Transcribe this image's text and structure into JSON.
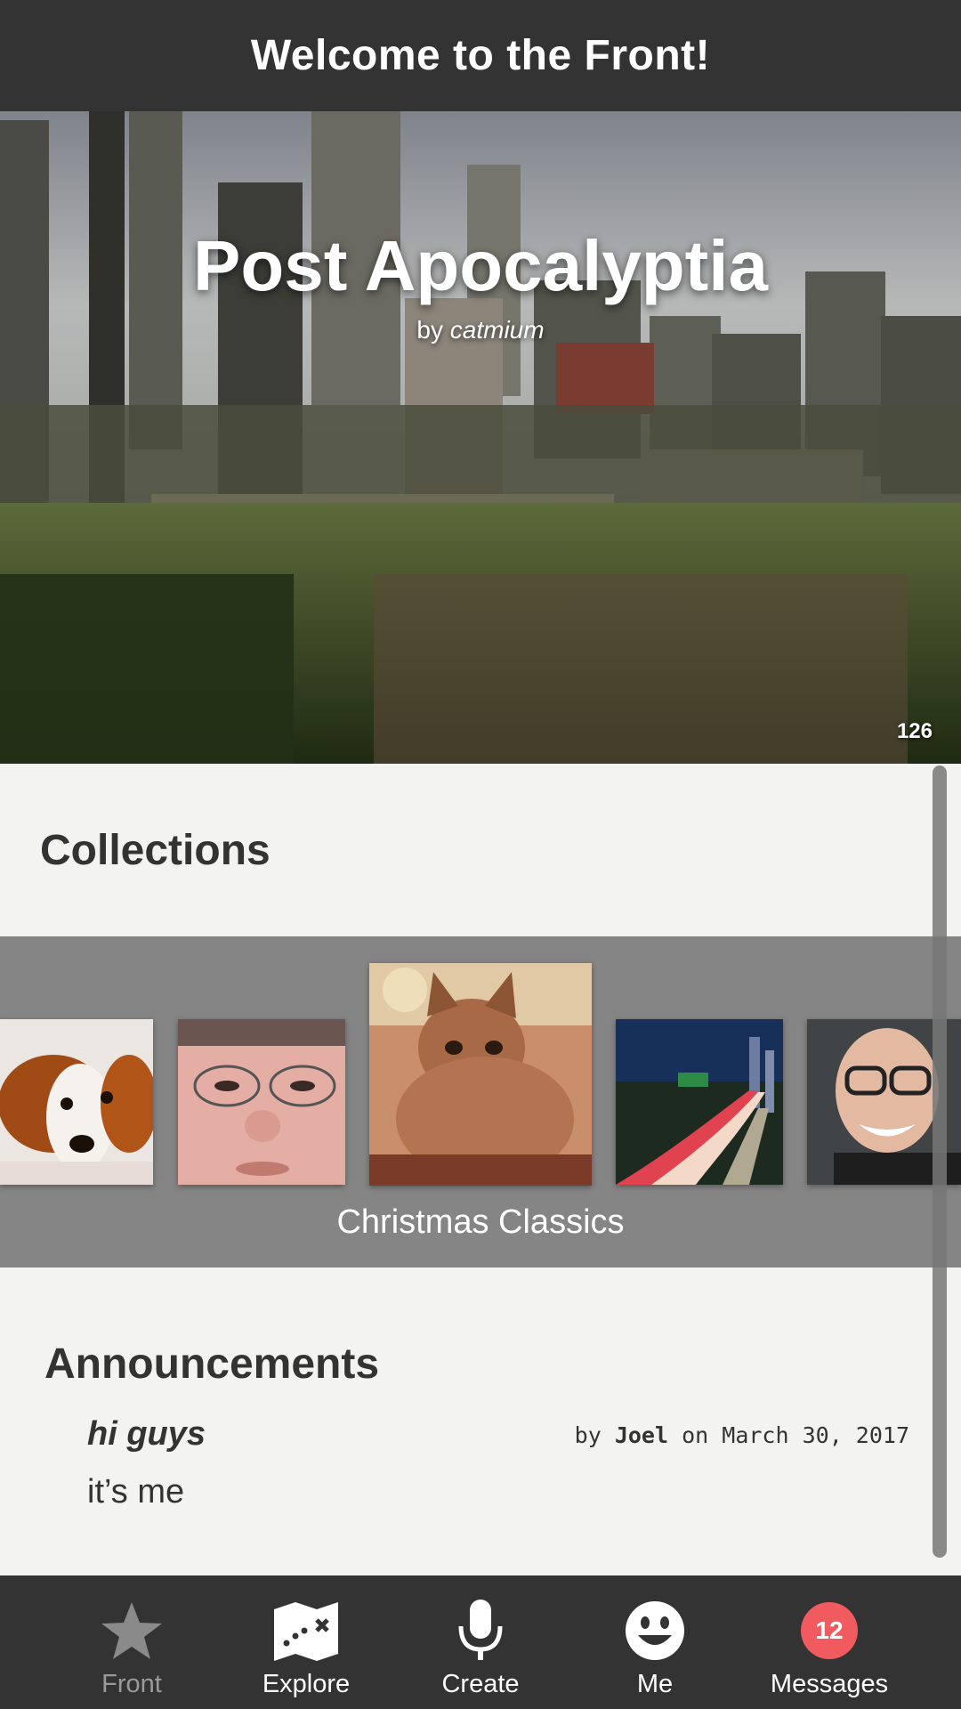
{
  "header": {
    "title": "Welcome to the Front!"
  },
  "featured": {
    "title": "Post Apocalyptia",
    "by_prefix": "by",
    "author": "catmium",
    "count": "126"
  },
  "collections": {
    "heading": "Collections",
    "current_label": "Christmas Classics",
    "thumbnails": [
      {
        "subject": "puppy"
      },
      {
        "subject": "girl-with-glasses"
      },
      {
        "subject": "cat"
      },
      {
        "subject": "city-highway-night"
      },
      {
        "subject": "smiling-man-with-glasses"
      }
    ]
  },
  "announcements": {
    "heading": "Announcements",
    "items": [
      {
        "title": "hi guys",
        "by_prefix": "by",
        "author": "Joel",
        "on_prefix": "on",
        "date": "March 30, 2017",
        "body": "it’s me"
      }
    ]
  },
  "nav": {
    "items": [
      {
        "label": "Front",
        "icon": "star-icon",
        "active": false
      },
      {
        "label": "Explore",
        "icon": "map-icon",
        "active": true
      },
      {
        "label": "Create",
        "icon": "microphone-icon",
        "active": true
      },
      {
        "label": "Me",
        "icon": "smiley-icon",
        "active": true
      },
      {
        "label": "Messages",
        "icon": "messages-badge",
        "badge": "12",
        "active": true
      }
    ]
  },
  "colors": {
    "bar": "#333333",
    "badge": "#f15a5f",
    "carousel": "#858585"
  }
}
